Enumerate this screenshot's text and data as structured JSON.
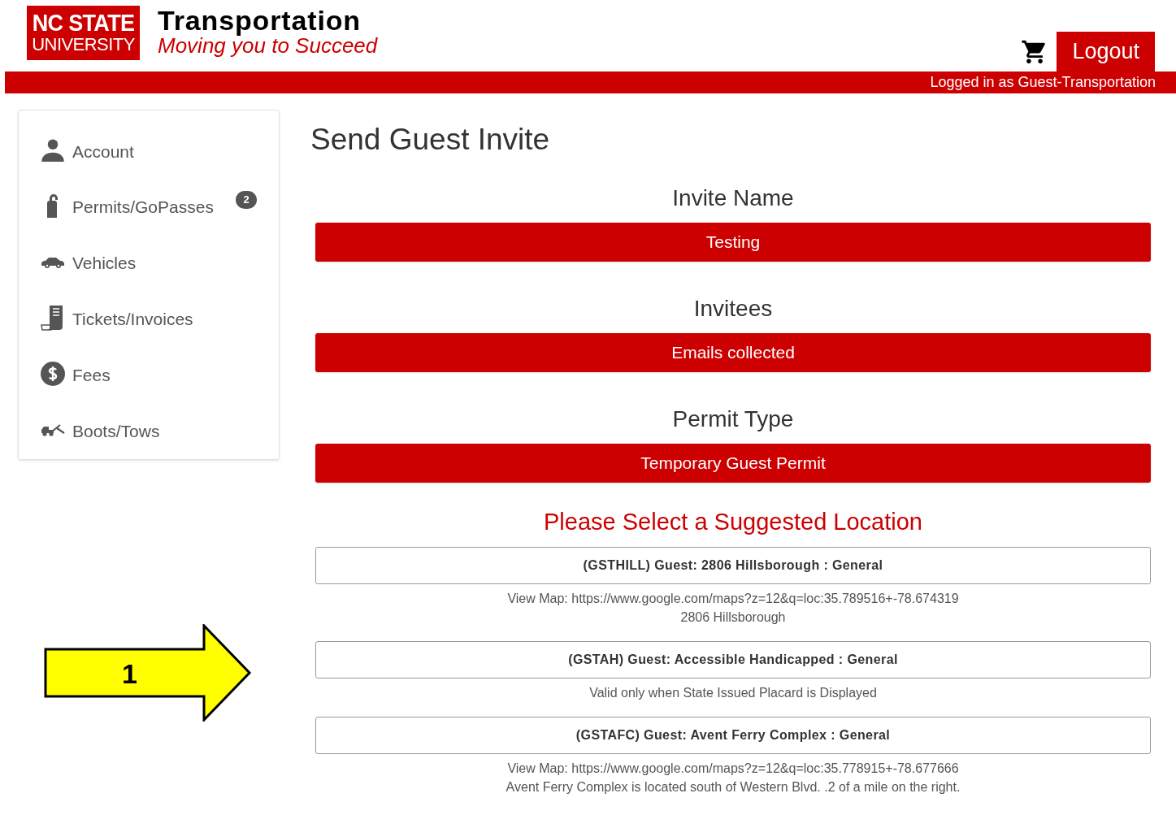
{
  "header": {
    "logo": {
      "line_1": "NC STATE",
      "line_2": "UNIVERSITY"
    },
    "title": "Transportation",
    "tagline": "Moving you to Succeed",
    "logout": "Logout",
    "logged_in": "Logged in as Guest-Transportation"
  },
  "sidebar": {
    "items": [
      {
        "label": "Account"
      },
      {
        "label": "Permits/GoPasses",
        "badge": "2"
      },
      {
        "label": "Vehicles"
      },
      {
        "label": "Tickets/Invoices"
      },
      {
        "label": "Fees"
      },
      {
        "label": "Boots/Tows"
      }
    ]
  },
  "page_title": "Send Guest Invite",
  "fields": [
    {
      "label": "Invite Name",
      "value": "Testing"
    },
    {
      "label": "Invitees",
      "value": "Emails collected"
    },
    {
      "label": "Permit Type",
      "value": "Temporary Guest Permit"
    }
  ],
  "location_prompt": "Please Select a Suggested Location",
  "locations": [
    {
      "label": "(GSTHILL) Guest: 2806 Hillsborough : General",
      "notes": [
        "View Map: https://www.google.com/maps?z=12&q=loc:35.789516+-78.674319",
        "2806 Hillsborough"
      ]
    },
    {
      "label": "(GSTAH) Guest: Accessible Handicapped : General",
      "notes": [
        "Valid only when State Issued Placard is Displayed"
      ]
    },
    {
      "label": "(GSTAFC) Guest: Avent Ferry Complex : General",
      "notes": [
        "View Map: https://www.google.com/maps?z=12&q=loc:35.778915+-78.677666",
        "Avent Ferry Complex is located south of Western Blvd. .2 of a mile on the right."
      ]
    }
  ],
  "callout": {
    "label": "1"
  }
}
